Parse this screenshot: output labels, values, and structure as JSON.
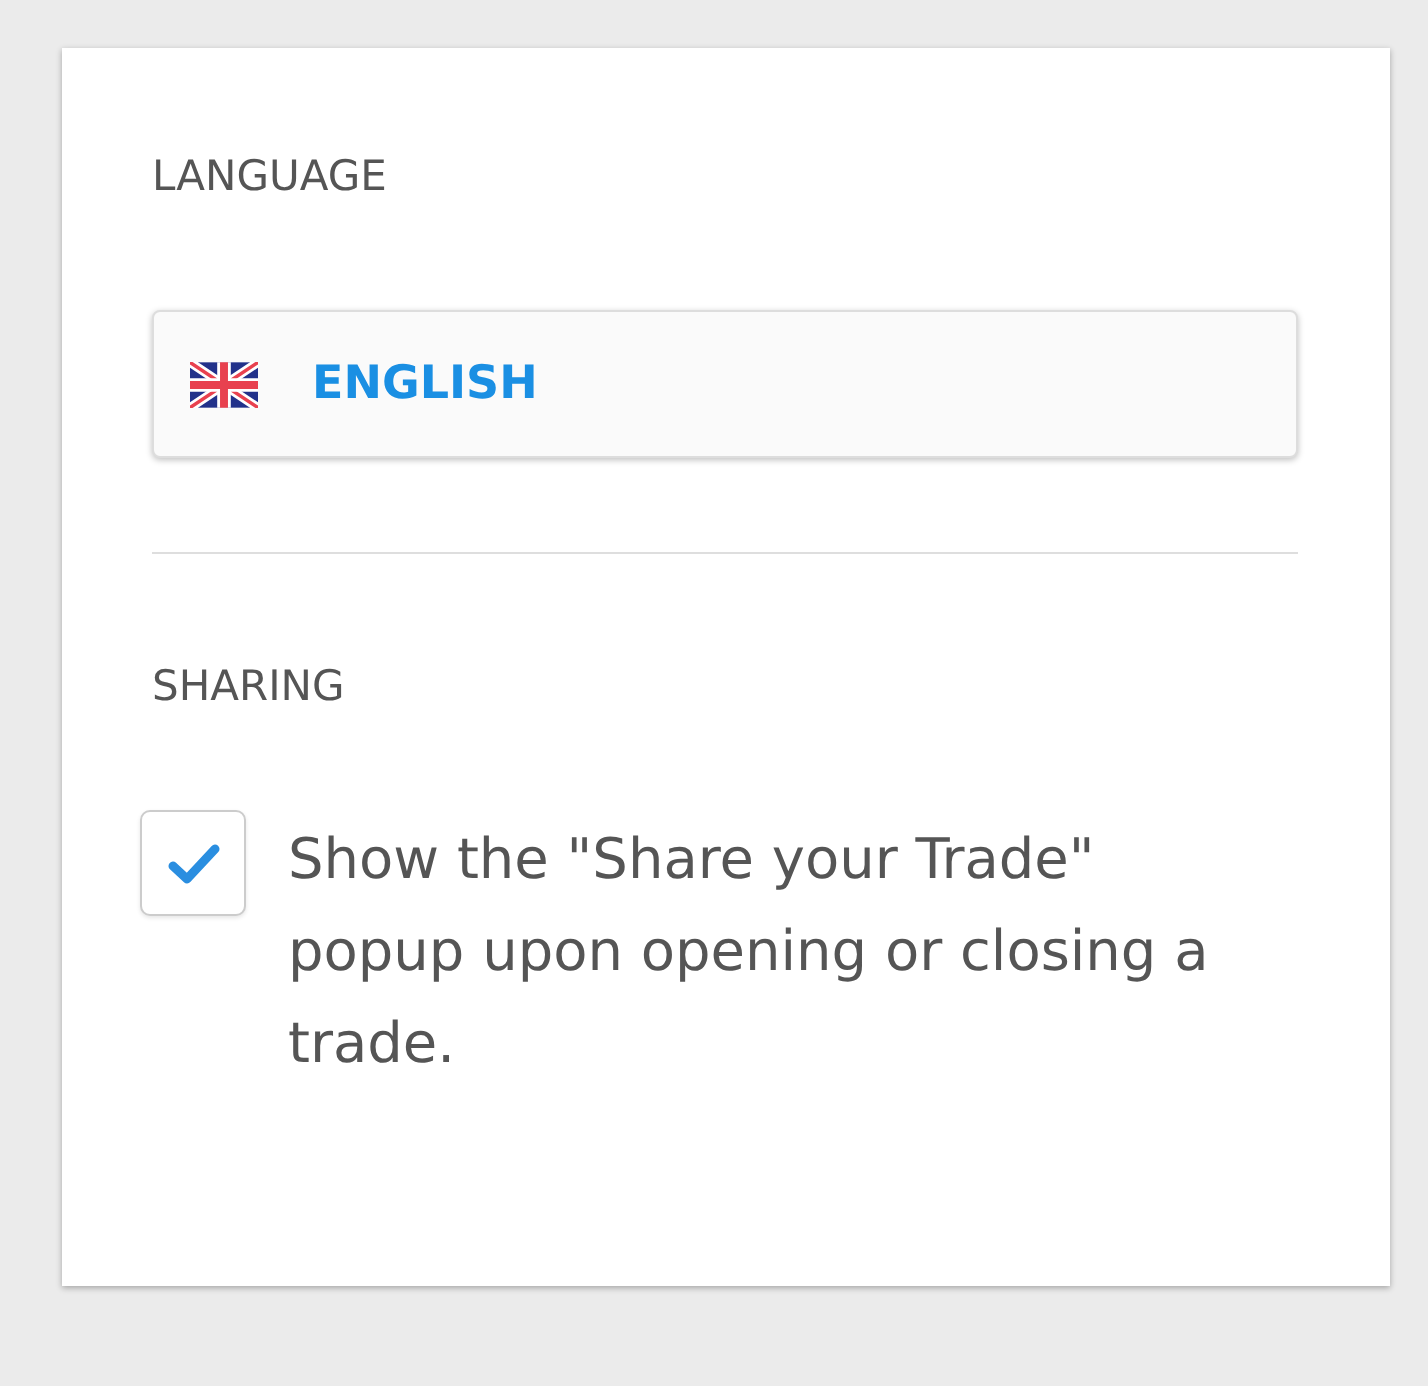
{
  "language": {
    "heading": "LANGUAGE",
    "selected_language": {
      "label": "ENGLISH"
    }
  },
  "sharing": {
    "heading": "SHARING",
    "option": {
      "label": "Show the \"Share your Trade\" popup upon opening or closing a trade.",
      "checked": true
    }
  }
}
